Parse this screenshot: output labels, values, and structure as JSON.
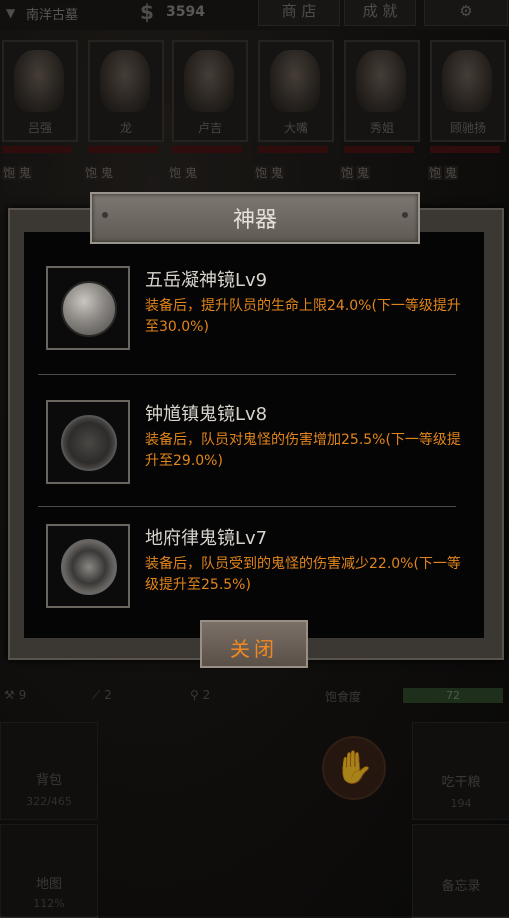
{
  "topbar": {
    "location": "南洋古墓",
    "money_symbol": "$",
    "money": "3594",
    "shop": "商 店",
    "achievements": "成 就"
  },
  "characters": [
    {
      "name": "吕强",
      "tags": [
        "饱",
        "鬼"
      ]
    },
    {
      "name": "龙",
      "tags": [
        "饱",
        "鬼"
      ]
    },
    {
      "name": "卢吉",
      "tags": [
        "饱",
        "鬼"
      ]
    },
    {
      "name": "大嘴",
      "tags": [
        "饱",
        "鬼"
      ]
    },
    {
      "name": "秀姐",
      "tags": [
        "饱",
        "鬼"
      ]
    },
    {
      "name": "顾驰扬",
      "tags": [
        "饱",
        "鬼"
      ]
    }
  ],
  "status": {
    "stat1": "9",
    "stat2": "2",
    "stat3": "2",
    "satiety_label": "饱食度",
    "satiety_value": "72",
    "satiety_fraction": 0.72
  },
  "tiles": {
    "bag_label": "背包",
    "bag_count": "322/465",
    "food_label": "吃干粮",
    "food_count": "194",
    "map_label": "地图",
    "map_pct": "112%",
    "memo_label": "备忘录"
  },
  "dialog": {
    "title": "神器",
    "items": [
      {
        "name": "五岳凝神镜Lv9",
        "desc": "装备后，提升队员的生命上限24.0%(下一等级提升至30.0%)",
        "icon": "mirror-icon"
      },
      {
        "name": "钟馗镇鬼镜Lv8",
        "desc": "装备后，队员对鬼怪的伤害增加25.5%(下一等级提升至29.0%)",
        "icon": "mirror-icon"
      },
      {
        "name": "地府律鬼镜Lv7",
        "desc": "装备后，队员受到的鬼怪的伤害减少22.0%(下一等级提升至25.5%)",
        "icon": "mirror-icon"
      }
    ],
    "close_label": "关闭"
  },
  "colors": {
    "desc": "#e2851c",
    "close_text": "#f08a20",
    "hp": "#4a1514"
  }
}
